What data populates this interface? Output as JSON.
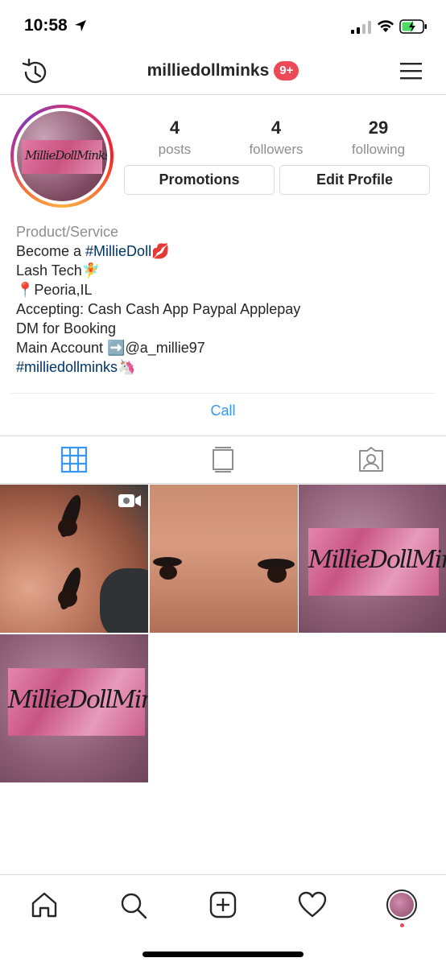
{
  "status_bar": {
    "time": "10:58"
  },
  "nav": {
    "username": "milliedollminks",
    "notification_badge": "9+"
  },
  "profile": {
    "avatar_text": "MillieDollMinks",
    "stats": [
      {
        "value": "4",
        "label": "posts"
      },
      {
        "value": "4",
        "label": "followers"
      },
      {
        "value": "29",
        "label": "following"
      }
    ],
    "buttons": {
      "promotions": "Promotions",
      "edit_profile": "Edit Profile"
    }
  },
  "bio": {
    "category": "Product/Service",
    "line1_prefix": "Become a ",
    "line1_tag": "#MillieDoll",
    "line1_emoji": "💋",
    "line2": "Lash Tech🧚",
    "line3": "📍Peoria,IL",
    "line4": "Accepting: Cash Cash App Paypal Applepay",
    "line5": "DM for Booking",
    "line6": "Main Account ➡️@a_millie97",
    "line7_tag": "#milliedollminks",
    "line7_emoji": "🦄"
  },
  "call_button": "Call",
  "grid": {
    "flyer_text": "MillieDollMinks"
  },
  "colors": {
    "link_blue": "#3897f0",
    "hashtag": "#003569",
    "badge_red": "#ed4956",
    "secondary_text": "#8e8e8e"
  },
  "icons": {
    "nav_left": "history-icon",
    "nav_right": "hamburger-menu-icon",
    "tabs": [
      "grid-icon",
      "igtv-icon",
      "tagged-icon"
    ],
    "bottom": [
      "home-icon",
      "search-icon",
      "new-post-icon",
      "activity-heart-icon",
      "profile-avatar-icon"
    ]
  }
}
